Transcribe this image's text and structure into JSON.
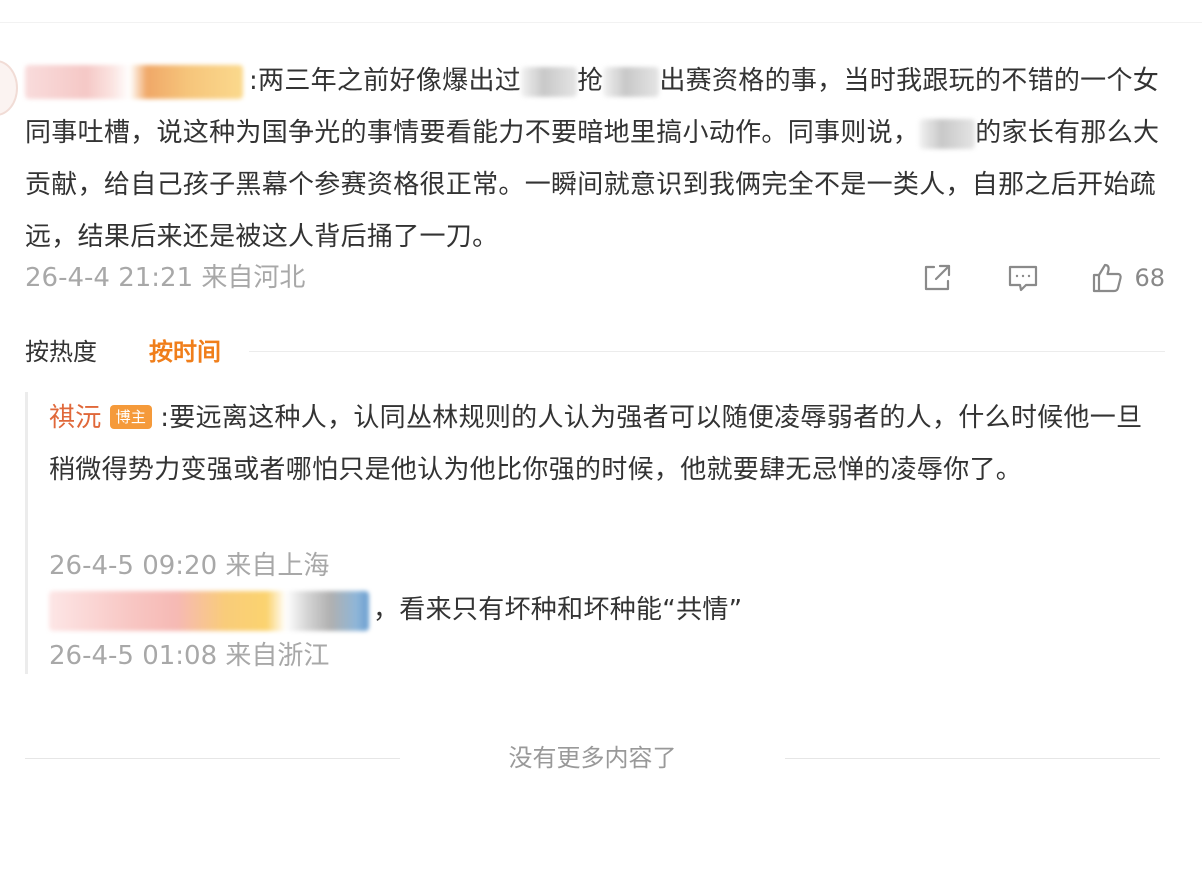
{
  "comment": {
    "text": ":两三年之前好像爆出过",
    "text_mid": "抢",
    "text_rest": "出赛资格的事，当时我跟玩的不错的一个女同事吐槽，说这种为国争光的事情要看能力不要暗地里搞小动作。同事则说，",
    "text_end": "的家长有那么大贡献，给自己孩子黑幕个参赛资格很正常。一瞬间就意识到我俩完全不是一类人，自那之后开始疏远，结果后来还是被这人背后捅了一刀。",
    "time": "26-4-4 21:21 来自河北",
    "like_count": "68",
    "icons": [
      "share-icon",
      "comment-icon",
      "like-icon"
    ]
  },
  "sort": {
    "hot_label": "按热度",
    "time_label": "按时间",
    "active": "time"
  },
  "replies": [
    {
      "name": "祺沅",
      "badge": "博主",
      "text": ":要远离这种人，认同丛林规则的人认为强者可以随便凌辱弱者的人，什么时候他一旦稍微得势力变强或者哪怕只是他认为他比你强的时候，他就要肆无忌惮的凌辱你了。",
      "time": "26-4-5 09:20 来自上海"
    },
    {
      "text": "，看来只有坏种和坏种能“共情”",
      "time": "26-4-5 01:08 来自浙江"
    }
  ],
  "footer": {
    "end_text": "没有更多内容了"
  },
  "colors": {
    "accent": "#f07e1a",
    "name": "#e0683a",
    "badge": "#f59a3a",
    "meta": "#a8a8a8"
  }
}
